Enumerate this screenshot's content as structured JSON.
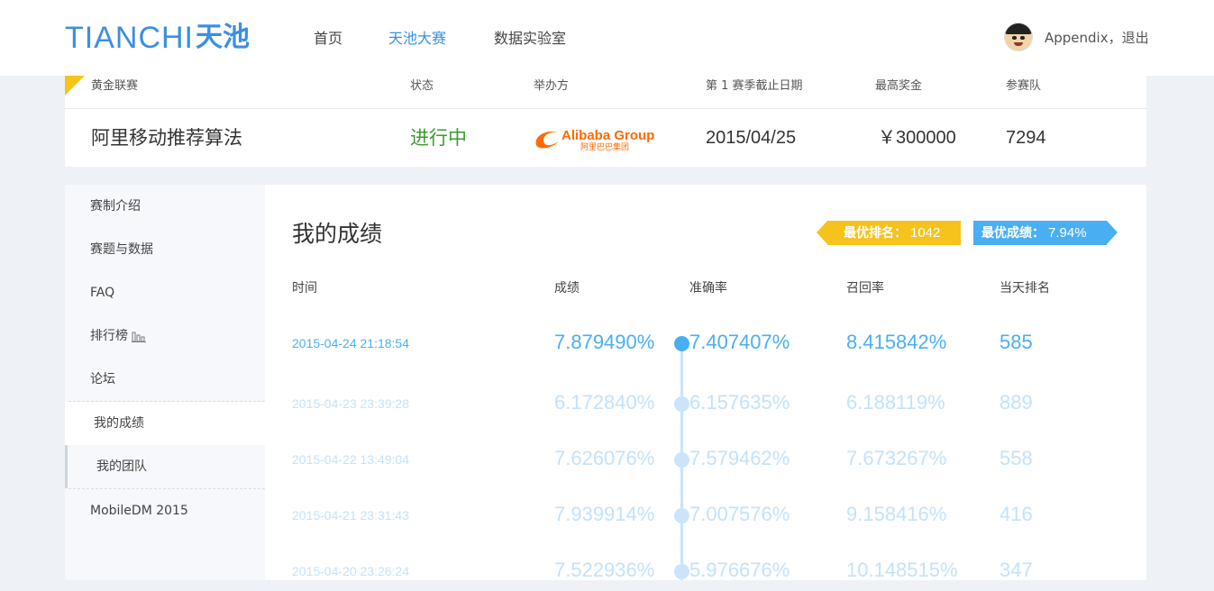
{
  "header": {
    "logo_en": "TIANCHI",
    "logo_cn": "天池",
    "nav": [
      "首页",
      "天池大赛",
      "数据实验室"
    ],
    "active_nav": "天池大赛",
    "user": "Appendix，退出"
  },
  "competition": {
    "league": "黄金联赛",
    "headers": {
      "status": "状态",
      "organizer": "举办方",
      "deadline": "第 1 赛季截止日期",
      "prize": "最高奖金",
      "teams": "参赛队"
    },
    "name": "阿里移动推荐算法",
    "status": "进行中",
    "organizer_logo_text": "Alibaba Group",
    "organizer_logo_cn": "阿里巴巴集团",
    "deadline": "2015/04/25",
    "prize": "￥300000",
    "teams": "7294"
  },
  "sidebar": {
    "items": [
      {
        "label": "赛制介绍"
      },
      {
        "label": "赛题与数据"
      },
      {
        "label": "FAQ"
      },
      {
        "label": "排行榜"
      },
      {
        "label": "论坛"
      },
      {
        "label": "我的成绩"
      },
      {
        "label": "我的团队"
      },
      {
        "label": "MobileDM 2015"
      }
    ]
  },
  "results": {
    "title": "我的成绩",
    "best_rank_label": "最优排名：",
    "best_rank": "1042",
    "best_score_label": "最优成绩：",
    "best_score": "7.94%",
    "columns": [
      "时间",
      "成绩",
      "准确率",
      "召回率",
      "当天排名"
    ],
    "rows": [
      {
        "time": "2015-04-24 21:18:54",
        "score": "7.879490%",
        "precision": "7.407407%",
        "recall": "8.415842%",
        "rank": "585"
      },
      {
        "time": "2015-04-23 23:39:28",
        "score": "6.172840%",
        "precision": "6.157635%",
        "recall": "6.188119%",
        "rank": "889"
      },
      {
        "time": "2015-04-22 13:49:04",
        "score": "7.626076%",
        "precision": "7.579462%",
        "recall": "7.673267%",
        "rank": "558"
      },
      {
        "time": "2015-04-21 23:31:43",
        "score": "7.939914%",
        "precision": "7.007576%",
        "recall": "9.158416%",
        "rank": "416"
      },
      {
        "time": "2015-04-20 23:26:24",
        "score": "7.522936%",
        "precision": "5.976676%",
        "recall": "10.148515%",
        "rank": "347"
      }
    ]
  },
  "colors": {
    "brand": "#3b8fe0",
    "status_green": "#3a9c2f",
    "rank_badge": "#f6c31c",
    "score_badge": "#4aaff2"
  }
}
